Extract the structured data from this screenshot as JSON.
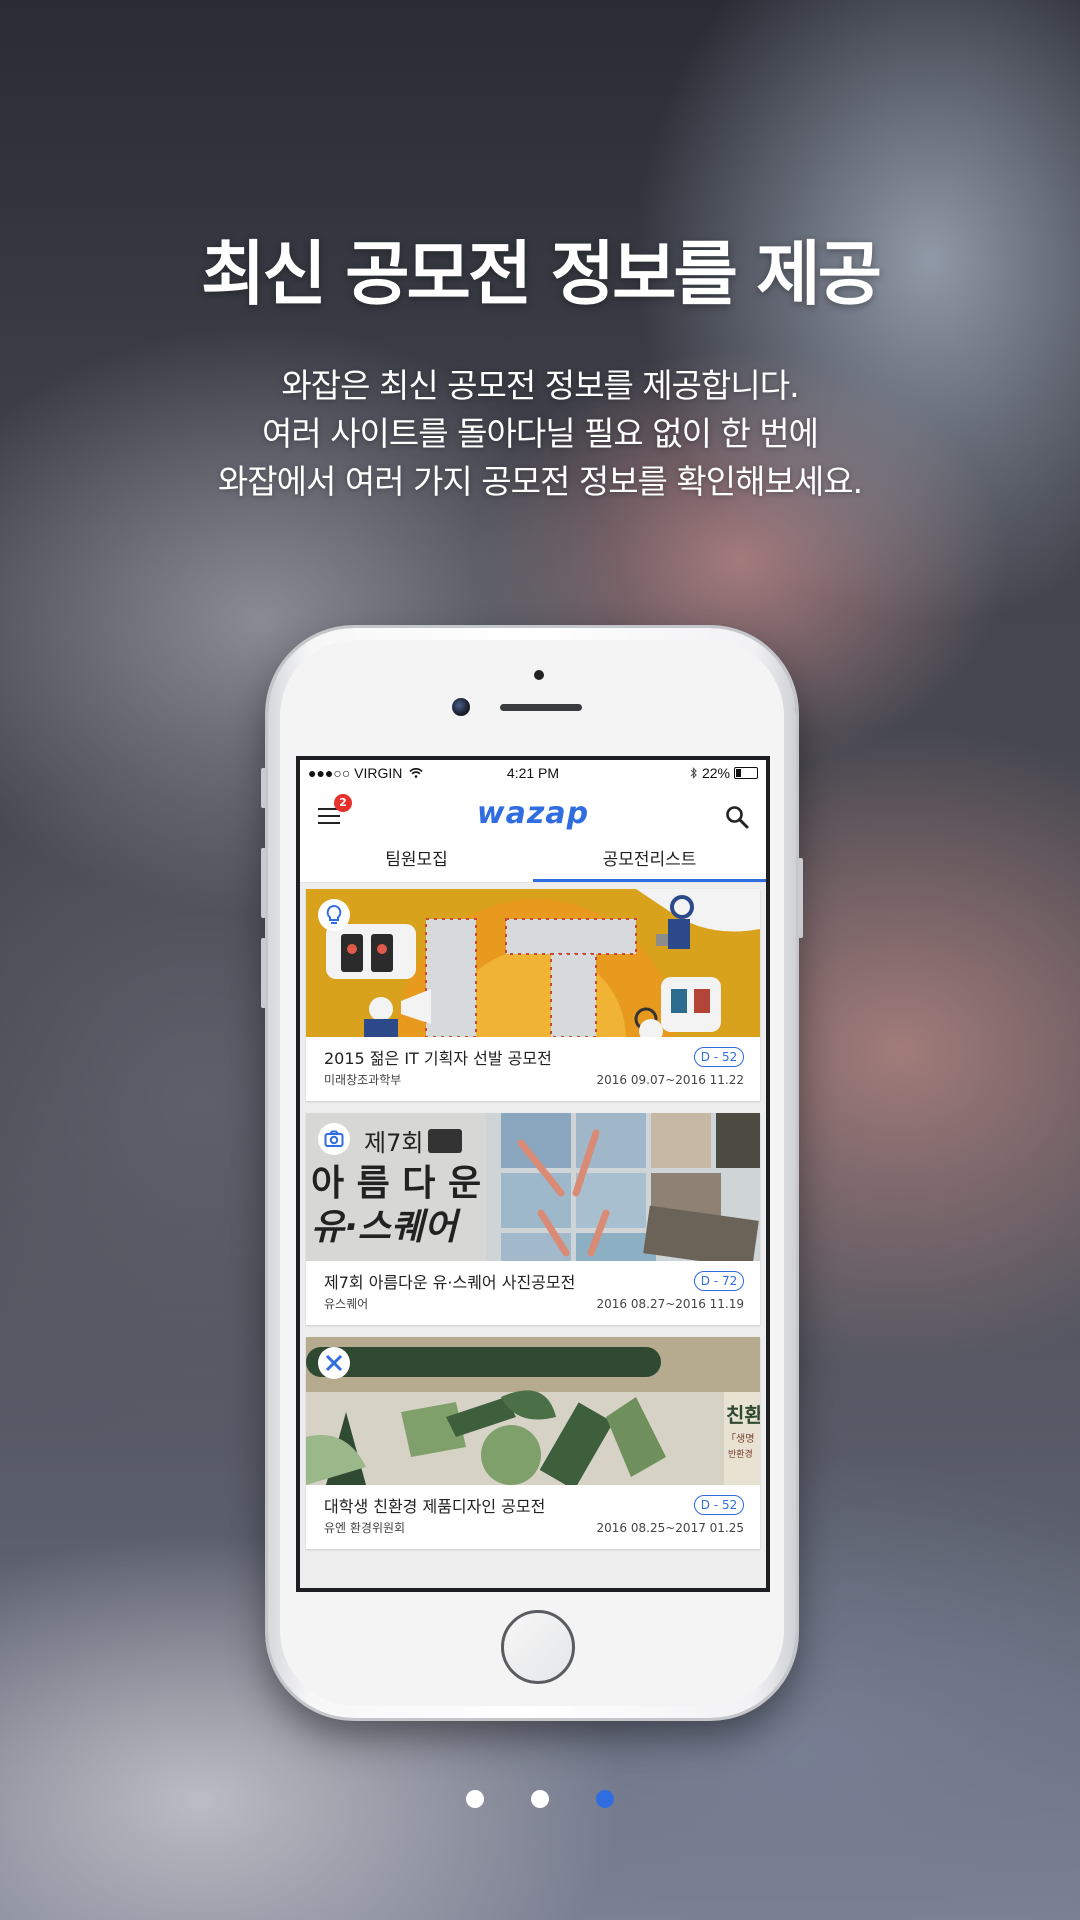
{
  "headline": "최신 공모전 정보를 제공",
  "description": [
    "와잡은 최신 공모전 정보를 제공합니다.",
    "여러 사이트를 돌아다닐 필요 없이 한 번에",
    "와잡에서 여러 가지 공모전 정보를 확인해보세요."
  ],
  "status_bar": {
    "carrier": "●●●○○ VIRGIN",
    "time": "4:21 PM",
    "battery": "22%"
  },
  "app": {
    "logo": "wazap",
    "notification_count": "2",
    "tabs": [
      {
        "label": "팀원모집",
        "active": false
      },
      {
        "label": "공모전리스트",
        "active": true
      }
    ]
  },
  "contests": [
    {
      "category_icon": "lightbulb-icon",
      "title": "2015 젊은 IT 기획자 선발 공모전",
      "organizer": "미래창조과학부",
      "dday": "D - 52",
      "period": "2016 09.07~2016 11.22",
      "image_text": "IT"
    },
    {
      "category_icon": "camera-icon",
      "title": "제7회 아름다운 유·스퀘어 사진공모전",
      "organizer": "유스퀘어",
      "dday": "D - 72",
      "period": "2016 08.27~2016 11.19",
      "image_text_line1": "제7회",
      "image_text_line2": "아 름 다 운",
      "image_text_line3": "유·스퀘어"
    },
    {
      "category_icon": "design-tools-icon",
      "title": "대학생 친환경 제품디자인 공모전",
      "organizer": "유엔 환경위원회",
      "dday": "D - 52",
      "period": "2016 08.25~2017 01.25",
      "image_text": "친환",
      "image_text_2": "「생명",
      "image_text_3": "반환경"
    }
  ],
  "pagination": {
    "total": 3,
    "active_index": 2
  },
  "colors": {
    "accent": "#2f6de0",
    "badge": "#e8312b"
  }
}
